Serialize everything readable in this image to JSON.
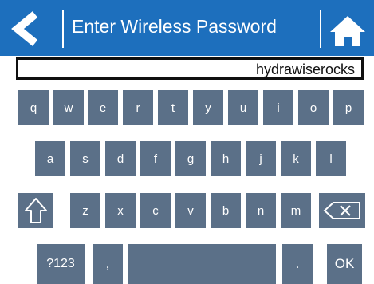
{
  "header": {
    "title": "Enter Wireless Password",
    "back_icon": "chevron-left-icon",
    "home_icon": "home-icon",
    "bg_color": "#1d6fbd"
  },
  "password_field": {
    "value": "hydrawiserocks"
  },
  "keyboard": {
    "key_color": "#5b7088",
    "row1": [
      "q",
      "w",
      "e",
      "r",
      "t",
      "y",
      "u",
      "i",
      "o",
      "p"
    ],
    "row2": [
      "a",
      "s",
      "d",
      "f",
      "g",
      "h",
      "j",
      "k",
      "l"
    ],
    "row3": [
      "z",
      "x",
      "c",
      "v",
      "b",
      "n",
      "m"
    ],
    "shift_icon": "shift-arrow-icon",
    "backspace_icon": "backspace-icon",
    "mode_label": "?123",
    "comma_label": ",",
    "period_label": ".",
    "ok_label": "OK"
  }
}
